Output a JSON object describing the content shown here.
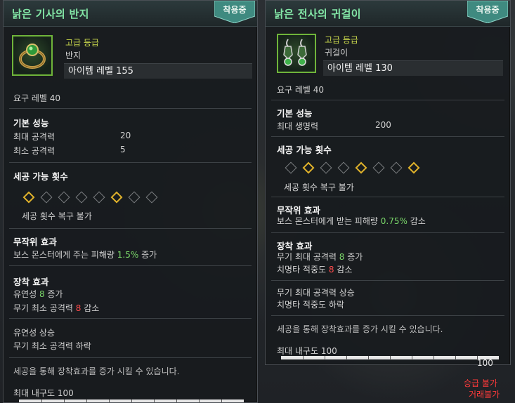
{
  "tooltip1": {
    "title": "낡은 기사의 반지",
    "equip_badge": "착용중",
    "grade": "고급 등급",
    "item_type": "반지",
    "item_level": "아이템 레벨 155",
    "required_level": "요구 레벨 40",
    "basic_header": "기본 성능",
    "stats": [
      {
        "label": "최대 공격력",
        "value": "20"
      },
      {
        "label": "최소 공격력",
        "value": "5"
      }
    ],
    "socket_header": "세공 가능 횟수",
    "socket_slots": [
      true,
      false,
      false,
      false,
      false,
      true,
      false,
      false
    ],
    "socket_note": "세공 횟수 복구 불가",
    "random_header": "무작위 효과",
    "random_effect": {
      "pre": "보스 몬스터에게 주는 피해량 ",
      "value": "1.5%",
      "post": " 증가"
    },
    "set_header": "장착 효과",
    "set_effects": [
      {
        "pre": "유연성 ",
        "value": "8",
        "post": " 증가",
        "color": "green"
      },
      {
        "pre": "무기 최소 공격력 ",
        "value": "8",
        "post": " 감소",
        "color": "red"
      }
    ],
    "trends": [
      "유연성 상승",
      "무기 최소 공격력 하락"
    ],
    "socket_hint": "세공을 통해 장착효과를 증가 시킬 수 있습니다.",
    "durability_label": "최대 내구도 100",
    "durability_fraction": 1.0,
    "colors": {
      "title": "#83e6a6",
      "grade": "#c9d84c",
      "positive": "#7bd86a",
      "negative": "#ff4b4b",
      "socket_on": "#e0b22b"
    }
  },
  "tooltip2": {
    "title": "낡은 전사의 귀걸이",
    "equip_badge": "착용중",
    "grade": "고급 등급",
    "item_type": "귀걸이",
    "item_level": "아이템 레벨 130",
    "required_level": "요구 레벨 40",
    "basic_header": "기본 성능",
    "stats": [
      {
        "label": "최대 생명력",
        "value": "200"
      }
    ],
    "socket_header": "세공 가능 횟수",
    "socket_slots": [
      false,
      true,
      false,
      false,
      true,
      false,
      false,
      true
    ],
    "socket_note": "세공 횟수 복구 불가",
    "random_header": "무작위 효과",
    "random_effect": {
      "pre": "보스 몬스터에게 받는 피해량 ",
      "value": "0.75%",
      "post": " 감소"
    },
    "set_header": "장착 효과",
    "set_effects": [
      {
        "pre": "무기 최대 공격력 ",
        "value": "8",
        "post": " 증가",
        "color": "green"
      },
      {
        "pre": "치명타 적중도 ",
        "value": "8",
        "post": " 감소",
        "color": "red"
      }
    ],
    "trends": [
      "무기 최대 공격력 상승",
      "치명타 적중도 하락"
    ],
    "socket_hint": "세공을 통해 장착효과를 증가 시킬 수 있습니다.",
    "durability_label": "최대 내구도 100",
    "durability_value": "100",
    "durability_fraction": 1.0,
    "trade_notes": [
      "승급 불가",
      "거래불가"
    ]
  },
  "icons": [
    "ring-icon",
    "earring-icon"
  ]
}
